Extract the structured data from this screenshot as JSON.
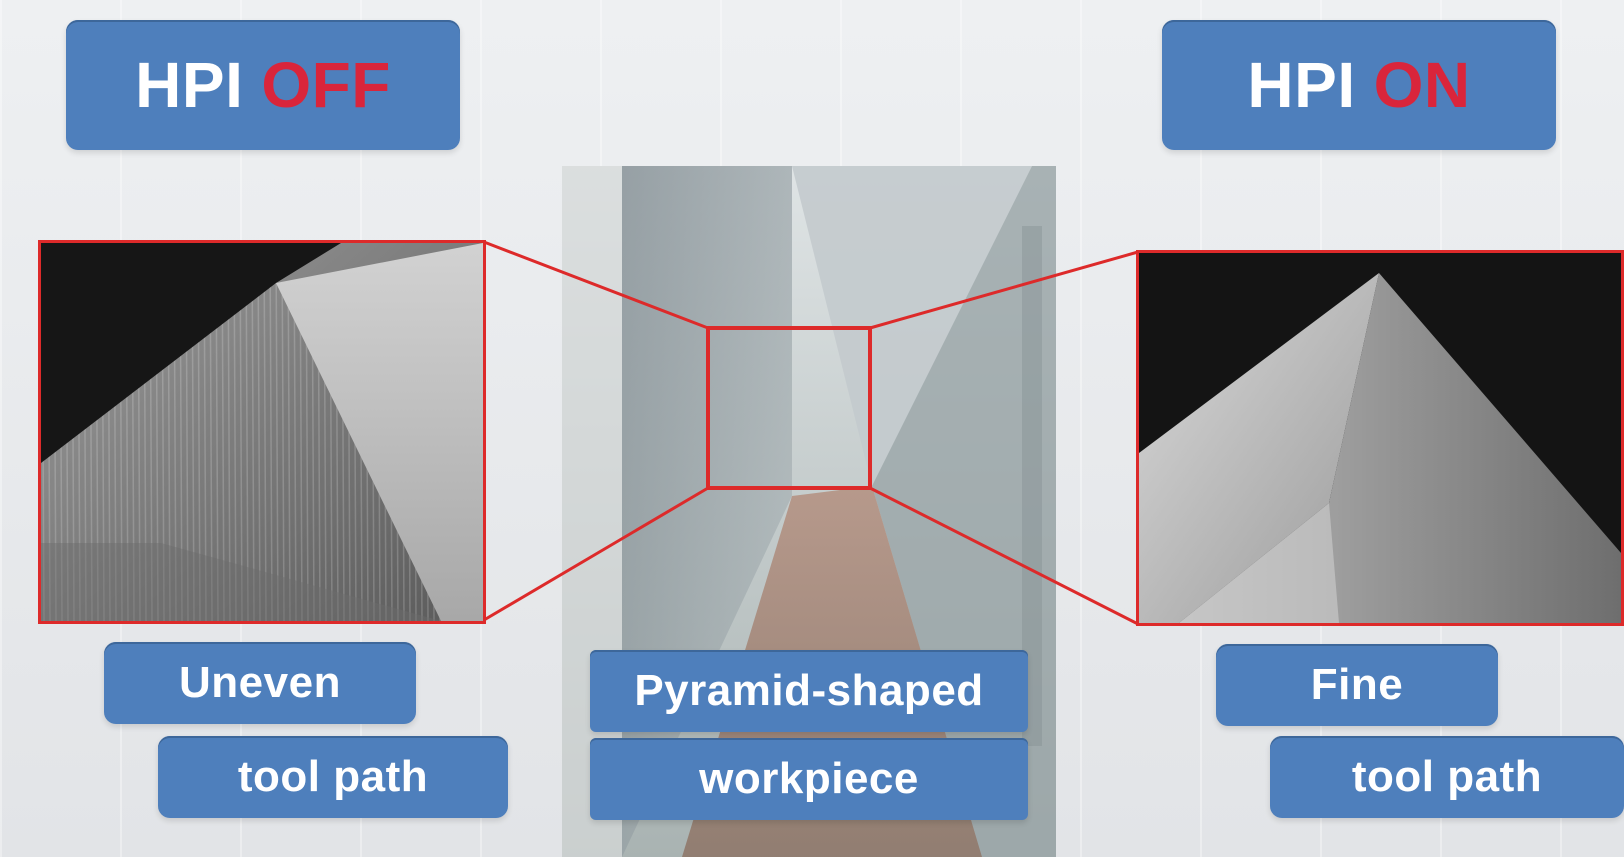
{
  "left_panel": {
    "hpi_label": "HPI",
    "hpi_state": "OFF",
    "caption_line1": "Uneven",
    "caption_line2": "tool path"
  },
  "center_panel": {
    "caption_line1": "Pyramid-shaped",
    "caption_line2": "workpiece"
  },
  "right_panel": {
    "hpi_label": "HPI",
    "hpi_state": "ON",
    "caption_line1": "Fine",
    "caption_line2": "tool path"
  },
  "colors": {
    "label_blue": "#4e7fbc",
    "state_red": "#d9253b",
    "zoom_frame_red": "#dd2a2a"
  }
}
